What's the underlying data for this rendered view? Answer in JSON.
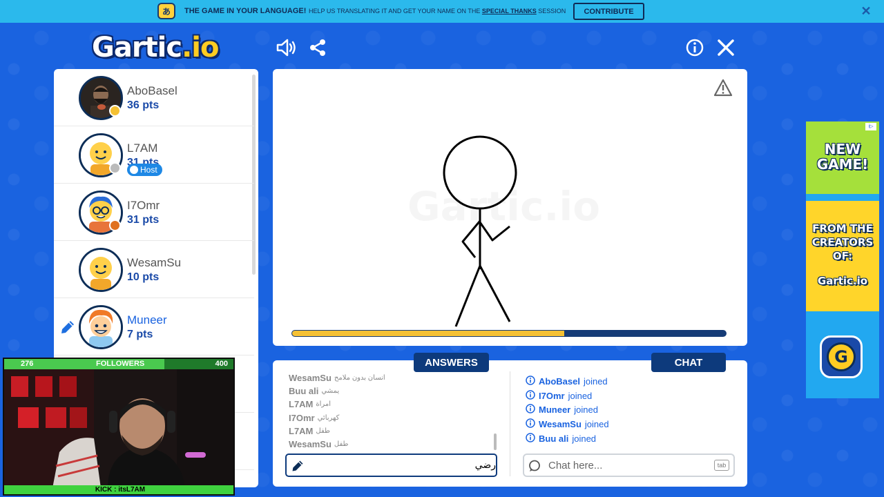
{
  "banner": {
    "headline": "THE GAME IN YOUR LANGUAGE!",
    "help_prefix": "HELP US TRANSLATING IT AND GET YOUR NAME ON THE ",
    "help_link": "SPECIAL THANKS",
    "help_suffix": " SESSION",
    "contribute_label": "CONTRIBUTE",
    "close_glyph": "✕"
  },
  "logo": {
    "main": "Gartic",
    "suffix": ".io"
  },
  "players": [
    {
      "name": "AboBasel",
      "pts": "36 pts",
      "status_color": "#f5c133",
      "avatar": "photo"
    },
    {
      "name": "L7AM",
      "pts": "31 pts",
      "status_color": "#bbbbbb",
      "avatar": "yellow",
      "badge": "Host"
    },
    {
      "name": "I7Omr",
      "pts": "31 pts",
      "status_color": "#e0711f",
      "avatar": "glasses"
    },
    {
      "name": "WesamSu",
      "pts": "10 pts",
      "status_color": "",
      "avatar": "yellow"
    },
    {
      "name": "Muneer",
      "pts": "7 pts",
      "status_color": "",
      "avatar": "boy",
      "drawing": true
    }
  ],
  "progress": {
    "fraction": 0.628
  },
  "tabs": {
    "answers": "ANSWERS",
    "chat": "CHAT"
  },
  "answers": [
    {
      "user": "WesamSu",
      "text": "انسان بدون ملامح"
    },
    {
      "user": "Buu ali",
      "text": "يمشي"
    },
    {
      "user": "L7AM",
      "text": "امراة"
    },
    {
      "user": "I7Omr",
      "text": "كهربائي"
    },
    {
      "user": "L7AM",
      "text": "طفل"
    },
    {
      "user": "WesamSu",
      "text": "طفل"
    }
  ],
  "answer_input": {
    "value": "رضي"
  },
  "chat": [
    {
      "user": "AboBasel",
      "text": "joined"
    },
    {
      "user": "I7Omr",
      "text": "joined"
    },
    {
      "user": "Muneer",
      "text": "joined"
    },
    {
      "user": "WesamSu",
      "text": "joined"
    },
    {
      "user": "Buu ali",
      "text": "joined"
    }
  ],
  "chat_input": {
    "placeholder": "Chat here...",
    "key_hint": "tab"
  },
  "ad": {
    "line1": "NEW",
    "line2": "GAME!",
    "line3": "FROM THE",
    "line4": "CREATORS",
    "line5": "OF:",
    "brand": "Gartic.io",
    "button_letter": "G",
    "choice": "i▷"
  },
  "stream": {
    "followers_current": "276",
    "followers_label": "FOLLOWERS",
    "followers_goal": "400",
    "followers_fraction": 0.69,
    "kick_label": "KICK : itsL7AM"
  },
  "colors": {
    "background": "#1a63e0",
    "banner": "#2bb9ec",
    "navy": "#0d3a7c",
    "progress_fill": "#f5c133",
    "chat_blue": "#1a63e0"
  }
}
